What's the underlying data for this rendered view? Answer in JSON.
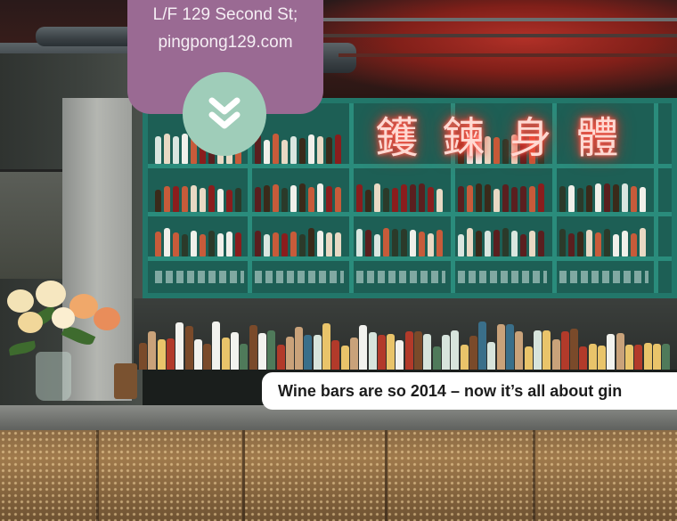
{
  "address": {
    "line1": "L/F 129 Second St;",
    "line2": "pingpong129.com"
  },
  "scroll_button": {
    "icon": "double-chevron-down-icon"
  },
  "caption": {
    "text": "Wine bars are so 2014 – now it’s all about gin"
  },
  "colors": {
    "card": "#9a6a93",
    "button": "#9fcdb9",
    "caption_bg": "#ffffff",
    "shelving": "#1d5f55",
    "neon": "#ff3b2e"
  }
}
